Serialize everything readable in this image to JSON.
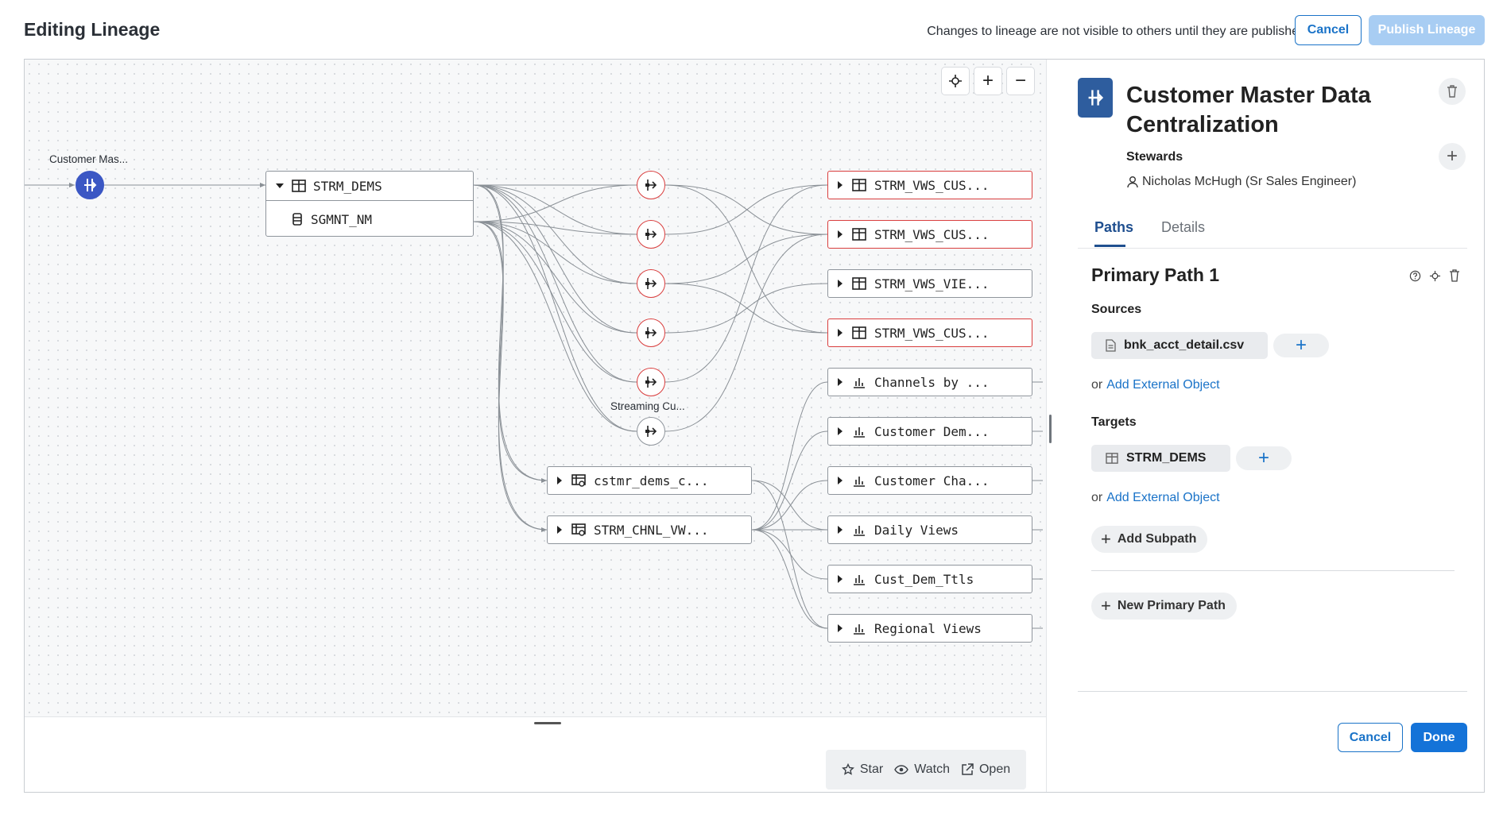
{
  "header": {
    "title": "Editing Lineage",
    "notice": "Changes to lineage are not visible to others until they are published",
    "cancel_label": "Cancel",
    "publish_label": "Publish Lineage"
  },
  "canvas": {
    "root_label": "Customer Mas...",
    "group_node": {
      "label": "STRM_DEMS",
      "child_label": "SGMNT_NM"
    },
    "transform_label": "Streaming Cu...",
    "target_nodes": [
      {
        "label": "STRM_VWS_CUS...",
        "icon": "table-icon",
        "highlight": true
      },
      {
        "label": "STRM_VWS_CUS...",
        "icon": "table-icon",
        "highlight": true
      },
      {
        "label": "STRM_VWS_VIE...",
        "icon": "table-icon",
        "highlight": false
      },
      {
        "label": "STRM_VWS_CUS...",
        "icon": "table-icon",
        "highlight": true
      },
      {
        "label": "Channels by ...",
        "icon": "chart-icon",
        "highlight": false
      },
      {
        "label": "Customer Dem...",
        "icon": "chart-icon",
        "highlight": false
      },
      {
        "label": "Customer Cha...",
        "icon": "chart-icon",
        "highlight": false
      },
      {
        "label": "Daily Views",
        "icon": "chart-icon",
        "highlight": false
      },
      {
        "label": "Cust_Dem_Ttls",
        "icon": "chart-icon",
        "highlight": false
      },
      {
        "label": "Regional Views",
        "icon": "chart-icon",
        "highlight": false
      }
    ],
    "mid_nodes": [
      {
        "label": "cstmr_dems_c...",
        "icon": "view-icon"
      },
      {
        "label": "STRM_CHNL_VW...",
        "icon": "view-icon"
      }
    ],
    "bottom_actions": {
      "star": "Star",
      "watch": "Watch",
      "open": "Open"
    }
  },
  "panel": {
    "title": "Customer Master Data Centralization",
    "stewards_label": "Stewards",
    "steward_name": "Nicholas McHugh (Sr Sales Engineer)",
    "tabs": [
      "Paths",
      "Details"
    ],
    "active_tab": "Paths",
    "path_title": "Primary Path 1",
    "sources_label": "Sources",
    "source_item": "bnk_acct_detail.csv",
    "targets_label": "Targets",
    "target_item": "STRM_DEMS",
    "or_text": "or",
    "add_external_label": "Add External Object",
    "add_subpath_label": "Add Subpath",
    "new_primary_path_label": "New Primary Path",
    "cancel_label": "Cancel",
    "done_label": "Done"
  },
  "colors": {
    "accent": "#1473d8",
    "highlight_border": "#d93d3d",
    "root_node": "#3b57c4",
    "panel_icon": "#2e5d9e"
  }
}
